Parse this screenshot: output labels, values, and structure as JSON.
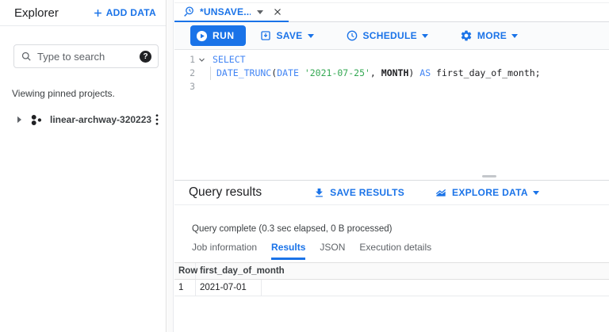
{
  "colors": {
    "accent_blue": "#1a73e8",
    "keyword_blue": "#4285f4",
    "string_green": "#34a853",
    "text_dark": "#202124",
    "text_gray": "#5f6368",
    "border": "#dadce0"
  },
  "sidebar": {
    "title": "Explorer",
    "add_data_label": "ADD DATA",
    "search_placeholder": "Type to search",
    "help_glyph": "?",
    "pinned_note": "Viewing pinned projects.",
    "project": {
      "name": "linear-archway-320223"
    }
  },
  "editor_tab": {
    "label": "*UNSAVE..."
  },
  "toolbar": {
    "run_label": "RUN",
    "save_label": "SAVE",
    "schedule_label": "SCHEDULE",
    "more_label": "MORE"
  },
  "code": {
    "line1": {
      "num": "1",
      "kw_select": "SELECT"
    },
    "line2": {
      "num": "2",
      "fn": "DATE_TRUNC",
      "paren_open": "(",
      "kw_date": "DATE",
      "sp": " ",
      "str": "'2021-07-25'",
      "comma": ", ",
      "datepart": "MONTH",
      "paren_close": ") ",
      "kw_as": "AS",
      "tail": " first_day_of_month;"
    },
    "line3": {
      "num": "3"
    }
  },
  "results": {
    "title": "Query results",
    "save_results_label": "SAVE RESULTS",
    "explore_data_label": "EXPLORE DATA",
    "status": "Query complete (0.3 sec elapsed, 0 B processed)",
    "tabs": [
      {
        "label": "Job information",
        "active": false
      },
      {
        "label": "Results",
        "active": true
      },
      {
        "label": "JSON",
        "active": false
      },
      {
        "label": "Execution details",
        "active": false
      }
    ],
    "table": {
      "columns": [
        "Row",
        "first_day_of_month"
      ],
      "rows": [
        [
          "1",
          "2021-07-01"
        ]
      ]
    }
  }
}
